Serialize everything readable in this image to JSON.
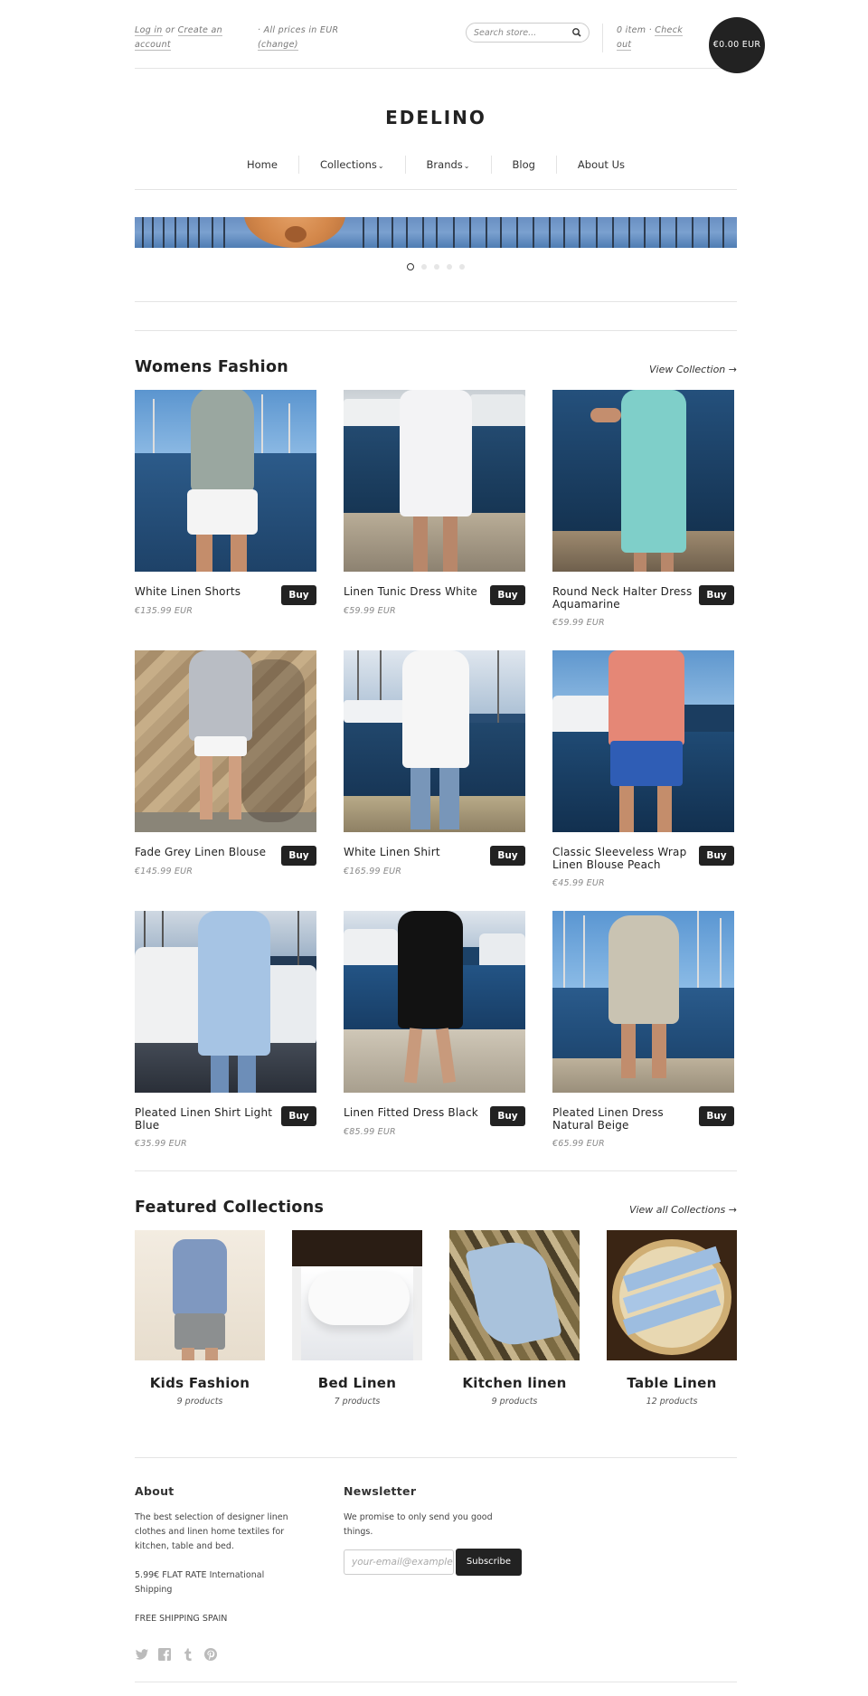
{
  "topbar": {
    "login_label": "Log in",
    "or_label": "or",
    "create_label": "Create an account",
    "prices_label": "All prices in EUR",
    "change_label": "(change)",
    "search_placeholder": "Search store...",
    "cart_count": "0 item",
    "checkout_label": "Check out",
    "cart_total": "€0.00 EUR"
  },
  "logo": "EDELINO",
  "nav": {
    "items": [
      "Home",
      "Collections",
      "Brands",
      "Blog",
      "About Us"
    ]
  },
  "womens": {
    "title": "Womens Fashion",
    "view_link": "View Collection →",
    "buy_label": "Buy",
    "products": [
      {
        "name": "White Linen Shorts",
        "price": "€135.99 EUR"
      },
      {
        "name": "Linen Tunic Dress White",
        "price": "€59.99 EUR"
      },
      {
        "name": "Round Neck Halter Dress Aquamarine",
        "price": "€59.99 EUR"
      },
      {
        "name": "Fade Grey Linen Blouse",
        "price": "€145.99 EUR"
      },
      {
        "name": "White Linen Shirt",
        "price": "€165.99 EUR"
      },
      {
        "name": "Classic Sleeveless Wrap Linen Blouse Peach",
        "price": "€45.99 EUR"
      },
      {
        "name": "Pleated Linen Shirt Light Blue",
        "price": "€35.99 EUR"
      },
      {
        "name": "Linen Fitted Dress Black",
        "price": "€85.99 EUR"
      },
      {
        "name": "Pleated Linen Dress Natural Beige",
        "price": "€65.99 EUR"
      }
    ]
  },
  "featured": {
    "title": "Featured Collections",
    "view_link": "View all Collections →",
    "collections": [
      {
        "name": "Kids Fashion",
        "count": "9 products"
      },
      {
        "name": "Bed Linen",
        "count": "7 products"
      },
      {
        "name": "Kitchen linen",
        "count": "9 products"
      },
      {
        "name": "Table Linen",
        "count": "12 products"
      }
    ]
  },
  "footer": {
    "about_title": "About",
    "about_text": "The best selection of designer linen clothes and linen home textiles for kitchen, table and bed.",
    "shipping_text": "5.99€ FLAT RATE International Shipping",
    "free_text": "FREE SHIPPING SPAIN",
    "newsletter_title": "Newsletter",
    "newsletter_text": "We promise to only send you good things.",
    "email_placeholder": "your-email@example.com",
    "subscribe_label": "Subscribe",
    "social_icons": [
      "twitter-icon",
      "facebook-icon",
      "tumblr-icon",
      "pinterest-icon"
    ]
  }
}
